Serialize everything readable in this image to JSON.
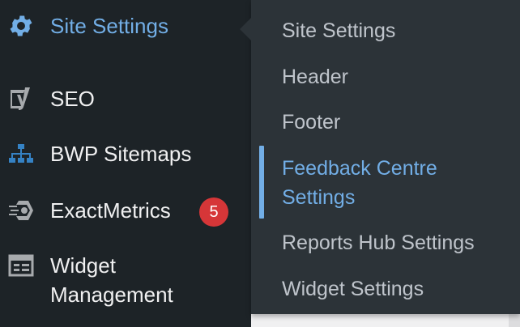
{
  "sidebar": {
    "items": [
      {
        "label": "Site Settings",
        "icon": "gear-icon",
        "active": true
      },
      {
        "label": "SEO",
        "icon": "yoast-icon"
      },
      {
        "label": "BWP Sitemaps",
        "icon": "sitemap-icon"
      },
      {
        "label": "ExactMetrics",
        "icon": "exactmetrics-icon",
        "badge": "5"
      },
      {
        "label_line1": "Widget",
        "label_line2": "Management",
        "icon": "widget-table-icon"
      }
    ]
  },
  "submenu": {
    "items": [
      {
        "label": "Site Settings"
      },
      {
        "label": "Header"
      },
      {
        "label": "Footer"
      },
      {
        "label_line1": "Feedback Centre",
        "label_line2": "Settings",
        "active": true
      },
      {
        "label": "Reports Hub Settings"
      },
      {
        "label": "Widget Settings"
      }
    ]
  },
  "colors": {
    "sidebar_bg": "#1d2327",
    "submenu_bg": "#2c3338",
    "accent": "#72aee6",
    "badge": "#d63638"
  }
}
